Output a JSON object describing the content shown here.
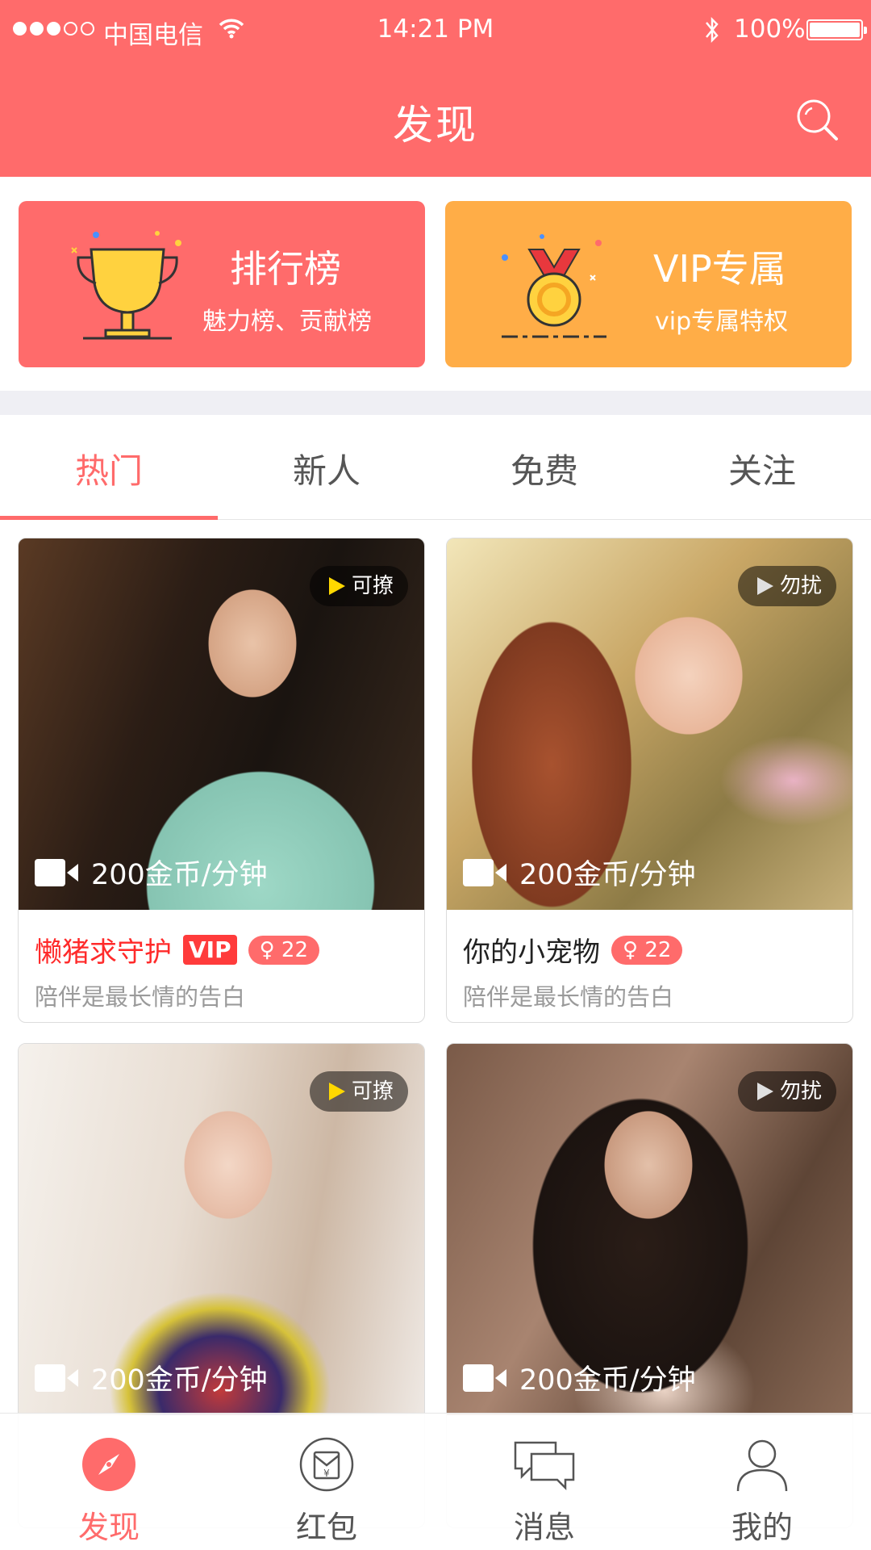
{
  "status_bar": {
    "carrier": "中国电信",
    "time": "14:21 PM",
    "battery": "100%"
  },
  "header": {
    "title": "发现"
  },
  "features": [
    {
      "title": "排行榜",
      "subtitle": "魅力榜、贡献榜",
      "icon": "trophy-icon",
      "color": "#ff6b6b"
    },
    {
      "title": "VIP专属",
      "subtitle": "vip专属特权",
      "icon": "medal-icon",
      "color": "#ffad47"
    }
  ],
  "tabs": [
    {
      "label": "热门",
      "active": true
    },
    {
      "label": "新人"
    },
    {
      "label": "免费"
    },
    {
      "label": "关注"
    }
  ],
  "cards": [
    {
      "name": "懒猪求守护",
      "vip": "VIP",
      "age": "22",
      "status": "可撩",
      "price": "200金币/分钟",
      "signature": "陪伴是最长情的告白"
    },
    {
      "name": "你的小宠物",
      "age": "22",
      "status": "勿扰",
      "price": "200金币/分钟",
      "signature": "陪伴是最长情的告白"
    },
    {
      "status": "可撩",
      "price": "200金币/分钟"
    },
    {
      "status": "勿扰",
      "price": "200金币/分钟"
    }
  ],
  "bottom_nav": [
    {
      "label": "发现",
      "icon": "compass-icon",
      "active": true
    },
    {
      "label": "红包",
      "icon": "red-packet-icon"
    },
    {
      "label": "消息",
      "icon": "message-icon"
    },
    {
      "label": "我的",
      "icon": "profile-icon"
    }
  ],
  "colors": {
    "primary": "#ff6b6b",
    "vip_orange": "#ffad47",
    "vip_red": "#ff3b3b"
  }
}
